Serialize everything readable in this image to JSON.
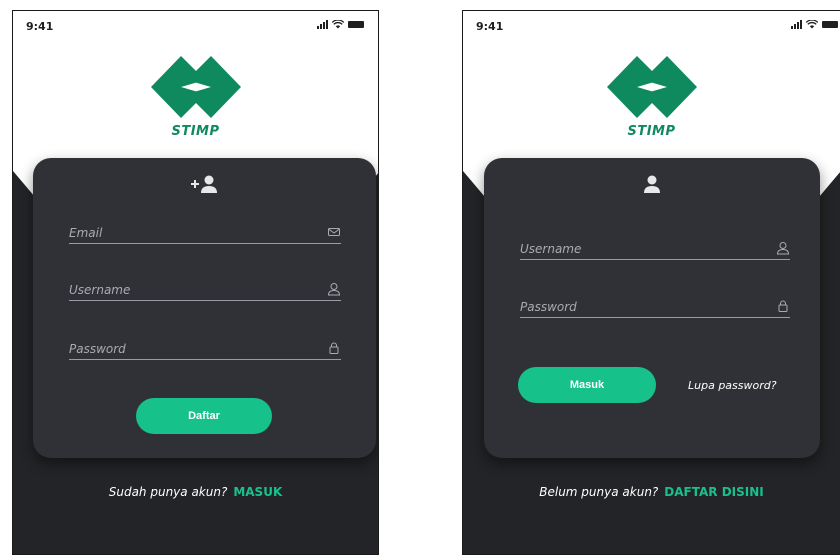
{
  "status_bar": {
    "time": "9:41"
  },
  "brand": {
    "name": "STIMP",
    "color": "#0f8a5f"
  },
  "accent_color": "#17c28a",
  "register_screen": {
    "header_icon": "add-user-icon",
    "fields": [
      {
        "label": "Email",
        "icon": "mail-icon"
      },
      {
        "label": "Username",
        "icon": "user-icon"
      },
      {
        "label": "Password",
        "icon": "lock-icon"
      }
    ],
    "submit_label": "Daftar",
    "footer_text": "Sudah punya akun?",
    "footer_link": "MASUK"
  },
  "login_screen": {
    "header_icon": "user-icon",
    "fields": [
      {
        "label": "Username",
        "icon": "user-icon"
      },
      {
        "label": "Password",
        "icon": "lock-icon"
      }
    ],
    "submit_label": "Masuk",
    "forgot_link": "Lupa password?",
    "footer_text": "Belum punya akun?",
    "footer_link": "DAFTAR DISINI"
  }
}
